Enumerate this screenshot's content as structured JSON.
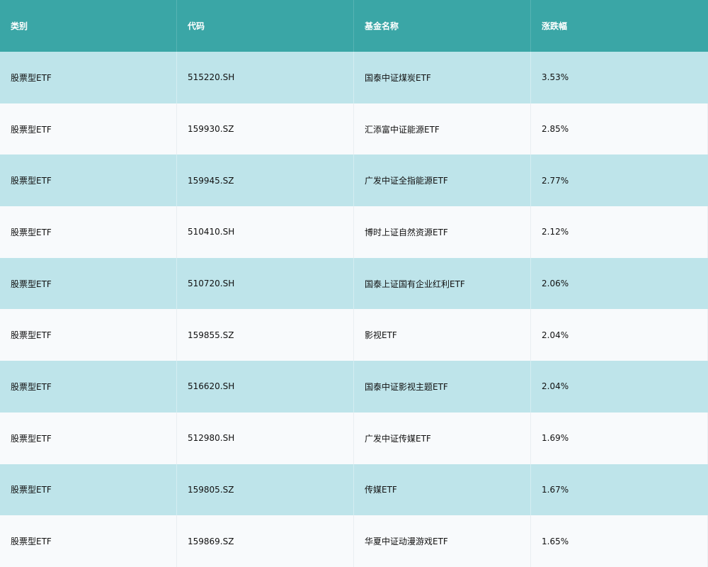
{
  "table": {
    "headers": [
      "类别",
      "代码",
      "基金名称",
      "涨跌幅"
    ],
    "rows": [
      {
        "category": "股票型ETF",
        "code": "515220.SH",
        "name": "国泰中证煤炭ETF",
        "change": "3.53%"
      },
      {
        "category": "股票型ETF",
        "code": "159930.SZ",
        "name": "汇添富中证能源ETF",
        "change": "2.85%"
      },
      {
        "category": "股票型ETF",
        "code": "159945.SZ",
        "name": "广发中证全指能源ETF",
        "change": "2.77%"
      },
      {
        "category": "股票型ETF",
        "code": "510410.SH",
        "name": "博时上证自然资源ETF",
        "change": "2.12%"
      },
      {
        "category": "股票型ETF",
        "code": "510720.SH",
        "name": "国泰上证国有企业红利ETF",
        "change": "2.06%"
      },
      {
        "category": "股票型ETF",
        "code": "159855.SZ",
        "name": "影视ETF",
        "change": "2.04%"
      },
      {
        "category": "股票型ETF",
        "code": "516620.SH",
        "name": "国泰中证影视主题ETF",
        "change": "2.04%"
      },
      {
        "category": "股票型ETF",
        "code": "512980.SH",
        "name": "广发中证传媒ETF",
        "change": "1.69%"
      },
      {
        "category": "股票型ETF",
        "code": "159805.SZ",
        "name": "传媒ETF",
        "change": "1.67%"
      },
      {
        "category": "股票型ETF",
        "code": "159869.SZ",
        "name": "华夏中证动漫游戏ETF",
        "change": "1.65%"
      }
    ]
  },
  "colors": {
    "header_bg": "#3aa6a6",
    "odd_row_bg": "#bee4ea",
    "even_row_bg": "#f8fafc"
  }
}
